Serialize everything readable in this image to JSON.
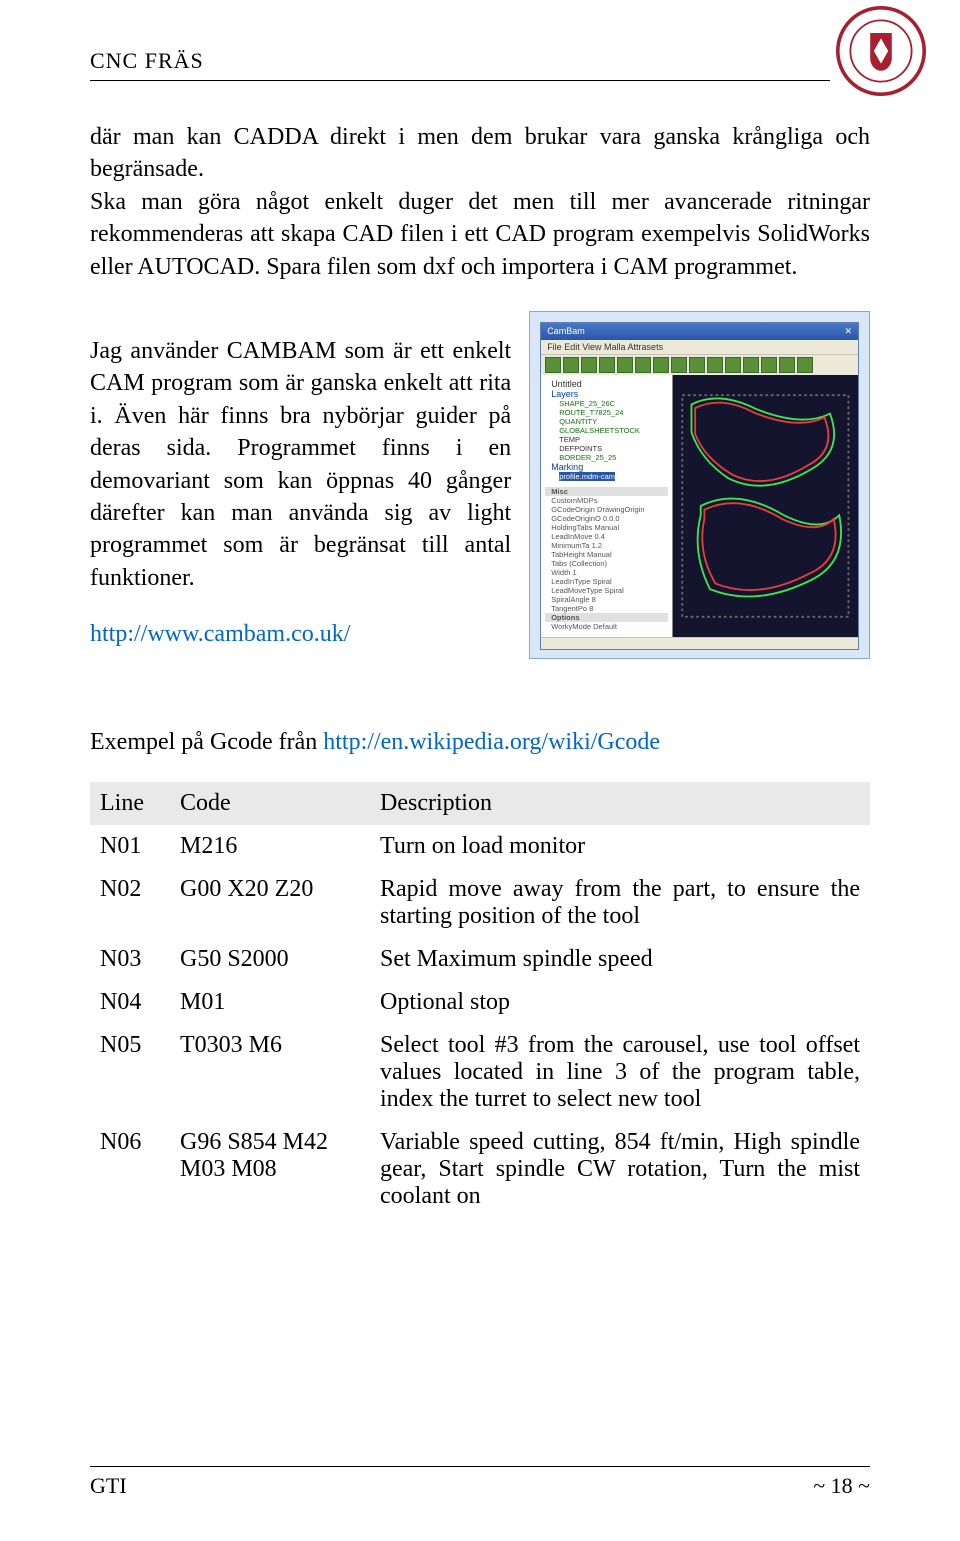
{
  "header": {
    "doc_title": "CNC FRÄS",
    "badge_alt": "Kvalificerad Yrkesutbildning badge"
  },
  "intro": {
    "p1": "där man kan CADDA direkt i men dem brukar vara ganska krångliga och begränsade.",
    "p2": "Ska man göra något enkelt duger det men till mer avancerade ritningar rekommenderas att skapa CAD filen i ett CAD program exempelvis SolidWorks eller AUTOCAD. Spara filen som dxf och importera i CAM programmet."
  },
  "cambam_text": {
    "para": "Jag använder CAMBAM som är ett enkelt CAM program som är ganska enkelt att rita i. Även här finns bra nybörjar guider på deras sida. Programmet finns i en demovariant som kan öppnas 40 gånger därefter kan man använda sig av light programmet som är begränsat till antal funktioner.",
    "link": "http://www.cambam.co.uk/"
  },
  "cambam_shot": {
    "title": "CamBam",
    "menu": "File  Edit  View  Malla  Attrasets",
    "tree": {
      "root": "Untitled",
      "layers": "Layers",
      "items": [
        "SHAPE_25_26C",
        "ROUTE_T7825_24",
        "QUANTITY",
        "GLOBALSHEETSTOCK",
        "TEMP",
        "DEFPOINTS",
        "BORDER_25_25"
      ],
      "marking": "Marking",
      "selected": "profile.mdm-cam",
      "props_header": "Misc",
      "props": [
        "CustomMDPs",
        "GCodeOrigin  DrawingOrigin",
        "GCodeOriginO  0.0.0",
        "HoldingTabs  Manual",
        "LeadInMove   0.4",
        "MinimumTa 1.2",
        "TabHeight  Manual",
        "Tabs   (Collection)",
        "Width  1",
        "LeadInType  Spiral",
        "LeadMoveType  Spiral",
        "SpiralAngle  8",
        "TangentPo  8",
        "Options",
        "WorkyMode  Default"
      ]
    }
  },
  "gcode_heading": {
    "prefix": "Exempel på Gcode från ",
    "url": "http://en.wikipedia.org/wiki/Gcode"
  },
  "gcode_table": {
    "headers": {
      "line": "Line",
      "code": "Code",
      "desc": "Description"
    },
    "rows": [
      {
        "line": "N01",
        "code": "M216",
        "desc": "Turn on load monitor"
      },
      {
        "line": "N02",
        "code": "G00 X20 Z20",
        "desc": "Rapid move away from the part, to ensure the starting position of the tool"
      },
      {
        "line": "N03",
        "code": "G50 S2000",
        "desc": "Set Maximum spindle speed"
      },
      {
        "line": "N04",
        "code": "M01",
        "desc": "Optional stop"
      },
      {
        "line": "N05",
        "code": "T0303 M6",
        "desc": "Select tool #3 from the carousel, use tool offset values located in line 3 of the program table, index the turret to select new tool"
      },
      {
        "line": "N06",
        "code": "G96 S854 M42 M03 M08",
        "desc": "Variable speed cutting, 854 ft/min, High spindle gear, Start spindle CW rotation, Turn the mist coolant on"
      }
    ]
  },
  "footer": {
    "left": "GTI",
    "right": "~ 18 ~"
  }
}
